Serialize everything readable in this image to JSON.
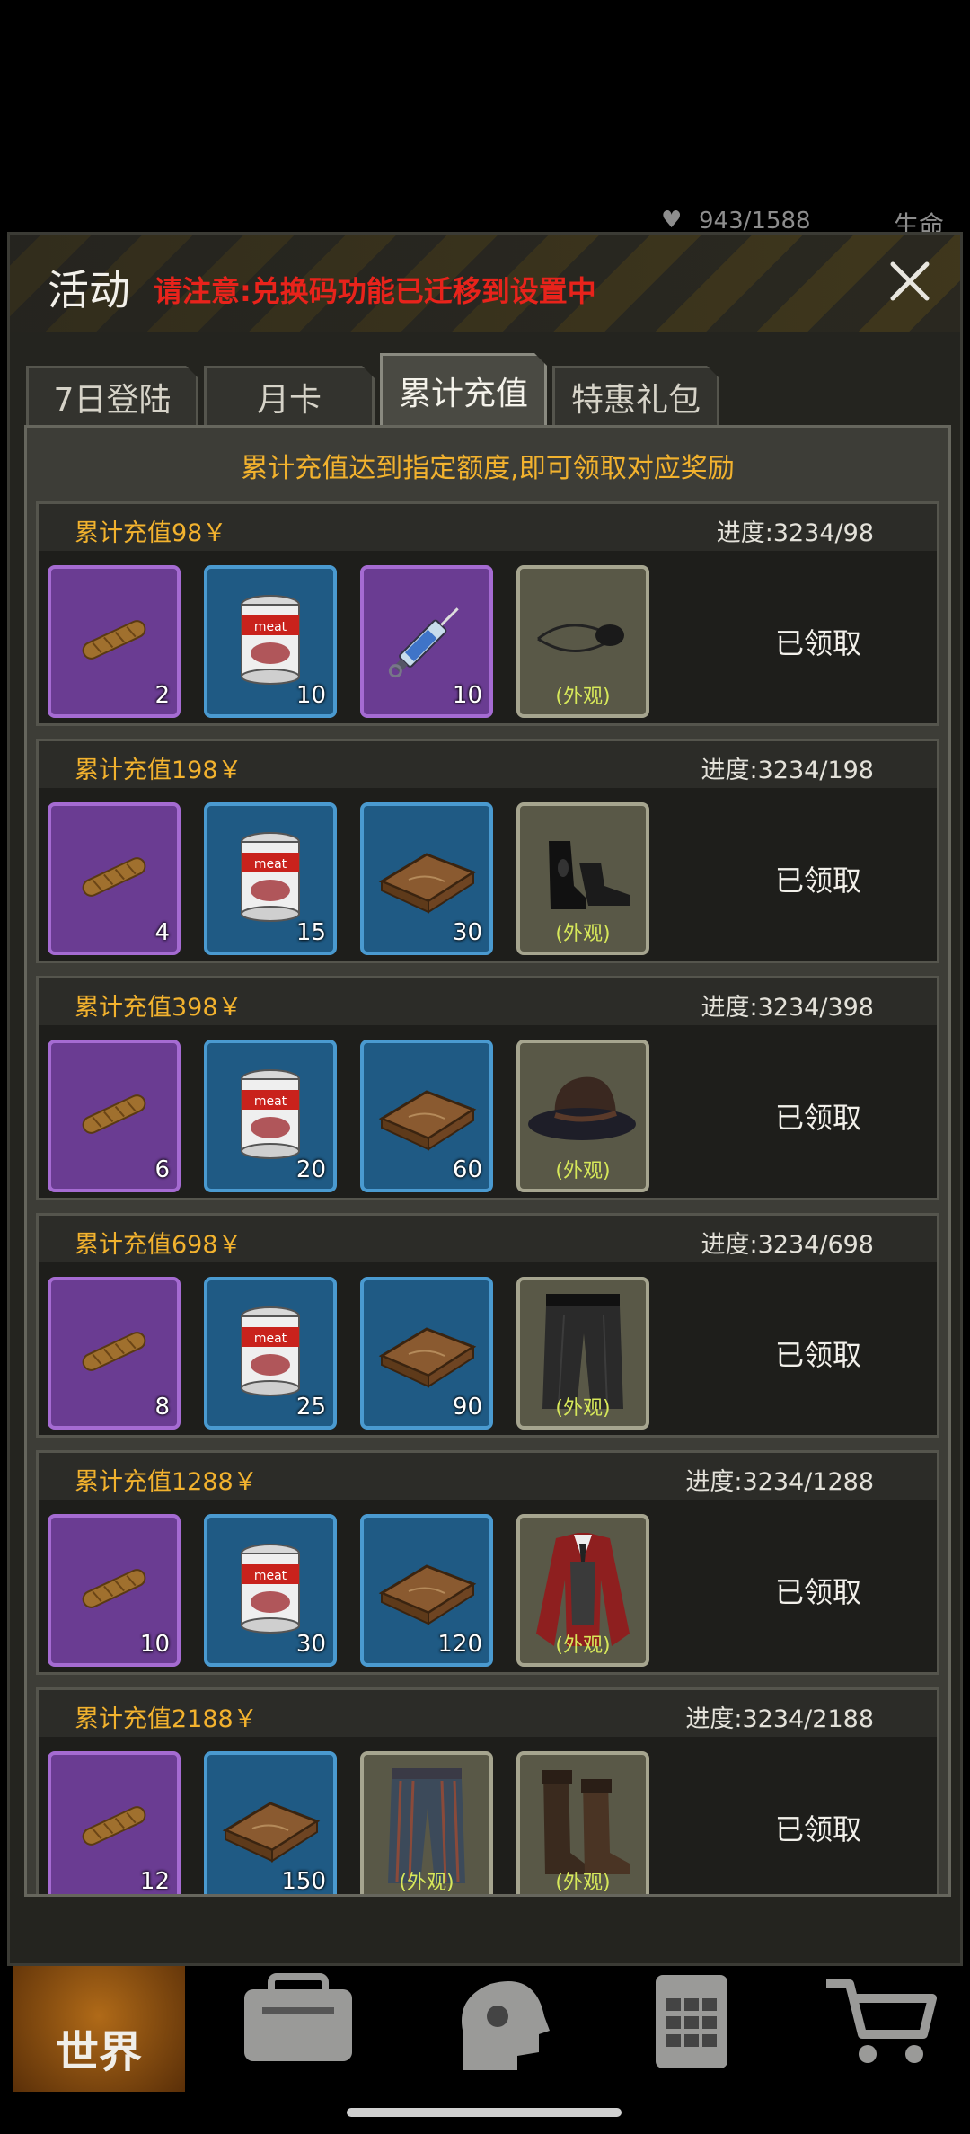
{
  "hud": {
    "hp": "943/1588",
    "life_label": "生命"
  },
  "header": {
    "title": "活动",
    "notice": "请注意:兑换码功能已迁移到设置中",
    "close_icon": "close-icon"
  },
  "tabs": [
    {
      "label": "7日登陆",
      "active": false
    },
    {
      "label": "月卡",
      "active": false
    },
    {
      "label": "累计充值",
      "active": true
    },
    {
      "label": "特惠礼包",
      "active": false
    }
  ],
  "subtitle": "累计充值达到指定额度,即可领取对应奖励",
  "tiers": [
    {
      "name": "累计充值98￥",
      "progress": "进度:3234/98",
      "status": "已领取",
      "items": [
        {
          "icon": "cigar-icon",
          "rarity": "purple",
          "count": "2"
        },
        {
          "icon": "meat-can-icon",
          "rarity": "blue",
          "count": "10"
        },
        {
          "icon": "syringe-icon",
          "rarity": "purple",
          "count": "10"
        },
        {
          "icon": "eyepatch-icon",
          "rarity": "gray",
          "tag": "(外观)"
        }
      ]
    },
    {
      "name": "累计充值198￥",
      "progress": "进度:3234/198",
      "status": "已领取",
      "items": [
        {
          "icon": "cigar-icon",
          "rarity": "purple",
          "count": "4"
        },
        {
          "icon": "meat-can-icon",
          "rarity": "blue",
          "count": "15"
        },
        {
          "icon": "wooden-crate-icon",
          "rarity": "blue",
          "count": "30"
        },
        {
          "icon": "shoes-icon",
          "rarity": "gray",
          "tag": "(外观)"
        }
      ]
    },
    {
      "name": "累计充值398￥",
      "progress": "进度:3234/398",
      "status": "已领取",
      "items": [
        {
          "icon": "cigar-icon",
          "rarity": "purple",
          "count": "6"
        },
        {
          "icon": "meat-can-icon",
          "rarity": "blue",
          "count": "20"
        },
        {
          "icon": "wooden-crate-icon",
          "rarity": "blue",
          "count": "60"
        },
        {
          "icon": "hat-icon",
          "rarity": "gray",
          "tag": "(外观)"
        }
      ]
    },
    {
      "name": "累计充值698￥",
      "progress": "进度:3234/698",
      "status": "已领取",
      "items": [
        {
          "icon": "cigar-icon",
          "rarity": "purple",
          "count": "8"
        },
        {
          "icon": "meat-can-icon",
          "rarity": "blue",
          "count": "25"
        },
        {
          "icon": "wooden-crate-icon",
          "rarity": "blue",
          "count": "90"
        },
        {
          "icon": "trousers-icon",
          "rarity": "gray",
          "tag": "(外观)"
        }
      ]
    },
    {
      "name": "累计充值1288￥",
      "progress": "进度:3234/1288",
      "status": "已领取",
      "items": [
        {
          "icon": "cigar-icon",
          "rarity": "purple",
          "count": "10"
        },
        {
          "icon": "meat-can-icon",
          "rarity": "blue",
          "count": "30"
        },
        {
          "icon": "wooden-crate-icon",
          "rarity": "blue",
          "count": "120"
        },
        {
          "icon": "red-coat-icon",
          "rarity": "gray",
          "tag": "(外观)"
        }
      ]
    },
    {
      "name": "累计充值2188￥",
      "progress": "进度:3234/2188",
      "status": "已领取",
      "items": [
        {
          "icon": "cigar-icon",
          "rarity": "purple",
          "count": "12"
        },
        {
          "icon": "wooden-crate-icon",
          "rarity": "blue",
          "count": "150"
        },
        {
          "icon": "striped-pants-icon",
          "rarity": "gray",
          "tag": "(外观)"
        },
        {
          "icon": "boots-icon",
          "rarity": "gray",
          "tag": "(外观)"
        }
      ]
    }
  ],
  "bottom_nav": {
    "world_label": "世界",
    "icons": [
      "backpack-icon",
      "head-profile-icon",
      "phone-keypad-icon",
      "shopping-cart-icon"
    ]
  }
}
